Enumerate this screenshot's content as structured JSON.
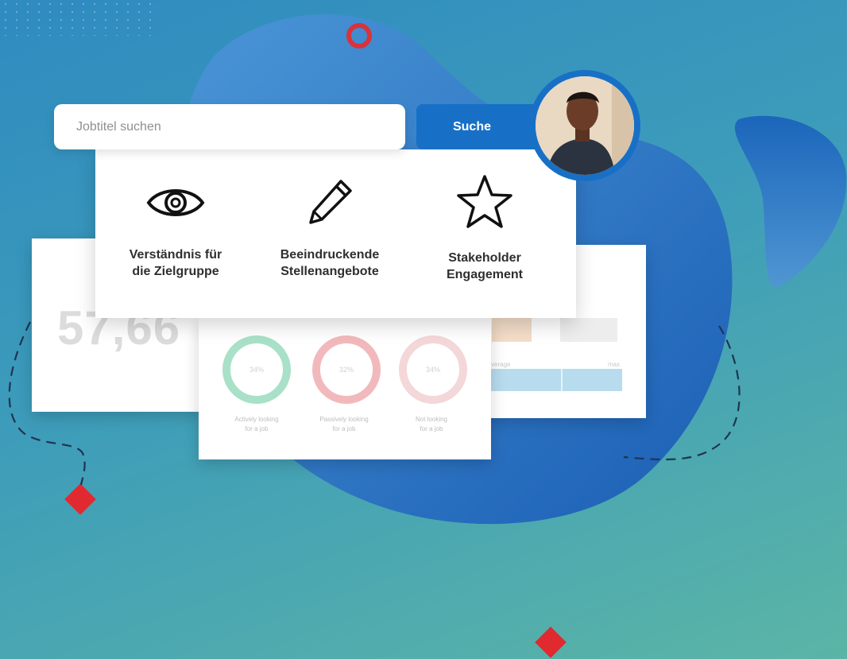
{
  "search": {
    "placeholder": "Jobtitel suchen",
    "button_label": "Suche"
  },
  "features": [
    {
      "icon": "eye-icon",
      "label_line1": "Verständnis für",
      "label_line2": "die Zielgruppe"
    },
    {
      "icon": "pencil-icon",
      "label_line1": "Beeindruckende",
      "label_line2": "Stellenangebote"
    },
    {
      "icon": "star-icon",
      "label_line1": "Stakeholder",
      "label_line2": "Engagement"
    }
  ],
  "background_cards": {
    "big_number": "57,66",
    "donuts": [
      {
        "percent": "34%",
        "label_line1": "Actively looking",
        "label_line2": "for a job",
        "color": "#a9e0c8"
      },
      {
        "percent": "32%",
        "label_line1": "Passively looking",
        "label_line2": "for a job",
        "color": "#f2b9bc"
      },
      {
        "percent": "34%",
        "label_line1": "Not looking",
        "label_line2": "for a job",
        "color": "#f4d7d8"
      }
    ],
    "bar_labels": {
      "left": "verage",
      "right": "max"
    }
  },
  "colors": {
    "accent_blue": "#1770c6",
    "blob_blue": "#1c63b8",
    "accent_red": "#e02a2f"
  }
}
